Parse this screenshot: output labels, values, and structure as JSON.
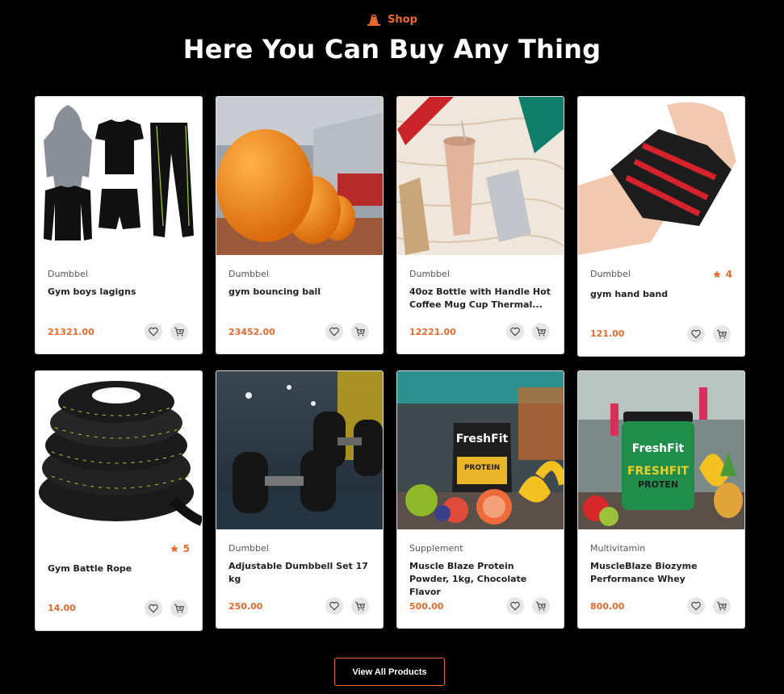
{
  "header": {
    "eyebrow": "Shop",
    "title": "Here You Can Buy Any Thing"
  },
  "products": [
    {
      "category": "Dumbbel",
      "name": "Gym boys lagigns",
      "price": "21321.00",
      "rating": "",
      "image": "sportswear-set"
    },
    {
      "category": "Dumbbel",
      "name": "gym bouncing ball",
      "price": "23452.00",
      "rating": "",
      "image": "orange-gym-ball"
    },
    {
      "category": "Dumbbel",
      "name": "40oz Bottle with Handle Hot Coffee Mug Cup Thermal...",
      "price": "12221.00",
      "rating": "",
      "image": "tumblers"
    },
    {
      "category": "Dumbbel",
      "name": "gym hand band",
      "price": "121.00",
      "rating": "4",
      "image": "wrist-wrap"
    },
    {
      "category": "",
      "name": "Gym Battle Rope",
      "price": "14.00",
      "rating": "5",
      "image": "battle-rope"
    },
    {
      "category": "Dumbbel",
      "name": "Adjustable Dumbbell Set 17 kg",
      "price": "250.00",
      "rating": "",
      "image": "dumbbells"
    },
    {
      "category": "Supplement",
      "name": "Muscle Blaze Protein Powder, 1kg, Chocolate Flavor",
      "price": "500.00",
      "rating": "",
      "image": "protein-pouch"
    },
    {
      "category": "Multivitamin",
      "name": "MuscleBlaze Biozyme Performance Whey",
      "price": "800.00",
      "rating": "",
      "image": "protein-jar"
    }
  ],
  "images": {
    "pouch_brand": "FreshFit",
    "pouch_label": "PROTEIN",
    "jar_brand": "FreshFit",
    "jar_label_1": "FRESHFIT",
    "jar_label_2": "PROTEN"
  },
  "cta": {
    "view_all": "View All Products"
  },
  "colors": {
    "accent": "#e8692c",
    "background": "#000000",
    "card": "#ffffff"
  },
  "icons": {
    "wishlist": "heart-icon",
    "cart": "cart-icon",
    "star": "star-icon",
    "eyebrow": "kettlebell-icon"
  }
}
